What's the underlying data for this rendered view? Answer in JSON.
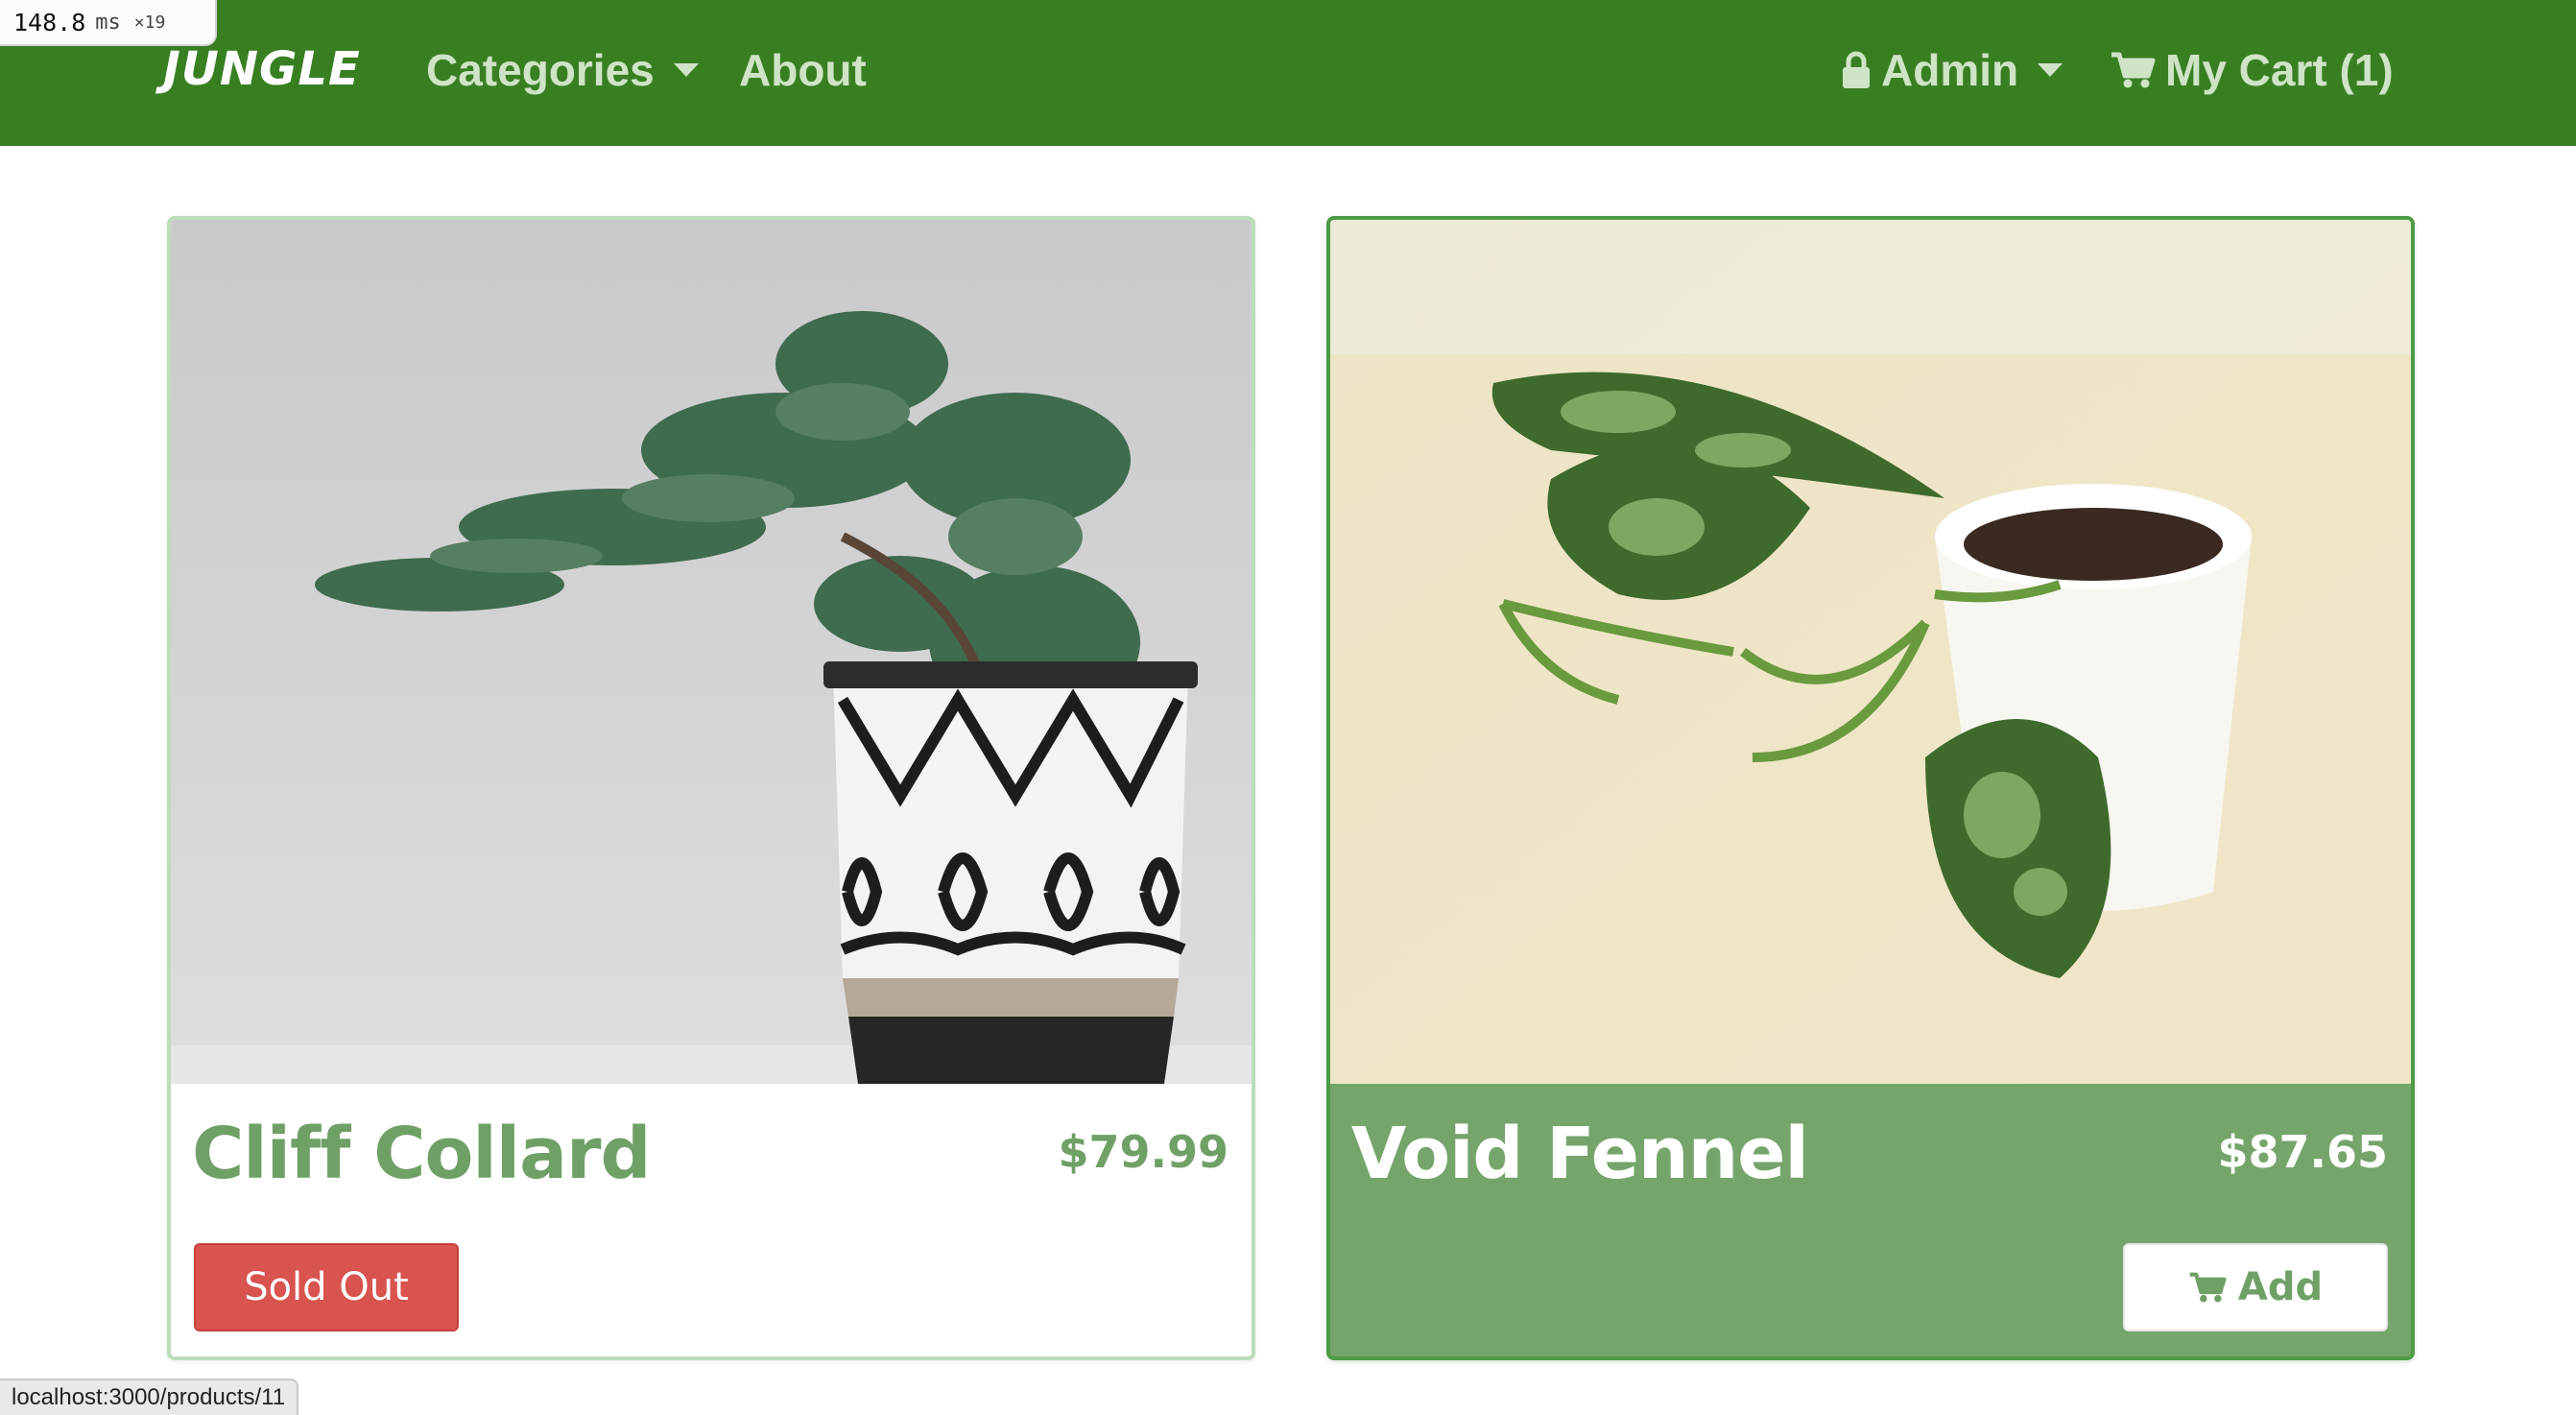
{
  "perf": {
    "value": "148.8",
    "unit": "ms",
    "multiplier": "×19"
  },
  "navbar": {
    "brand": "JUNGLE",
    "categories_label": "Categories",
    "about_label": "About",
    "admin_label": "Admin",
    "cart_label": "My Cart (1)",
    "icons": {
      "lock": "lock-icon",
      "cart": "cart-icon",
      "caret": "caret-down-icon"
    }
  },
  "products": [
    {
      "name": "Cliff Collard",
      "price": "$79.99",
      "action_label": "Sold Out",
      "status": "sold-out"
    },
    {
      "name": "Void Fennel",
      "price": "$87.65",
      "action_label": "Add",
      "status": "available"
    }
  ],
  "status_bar": {
    "url": "localhost:3000/products/11"
  },
  "colors": {
    "navbar": "#387f22",
    "accent_green": "#6fa066",
    "active_card": "#75a56b",
    "sold_out": "#d9534f"
  }
}
